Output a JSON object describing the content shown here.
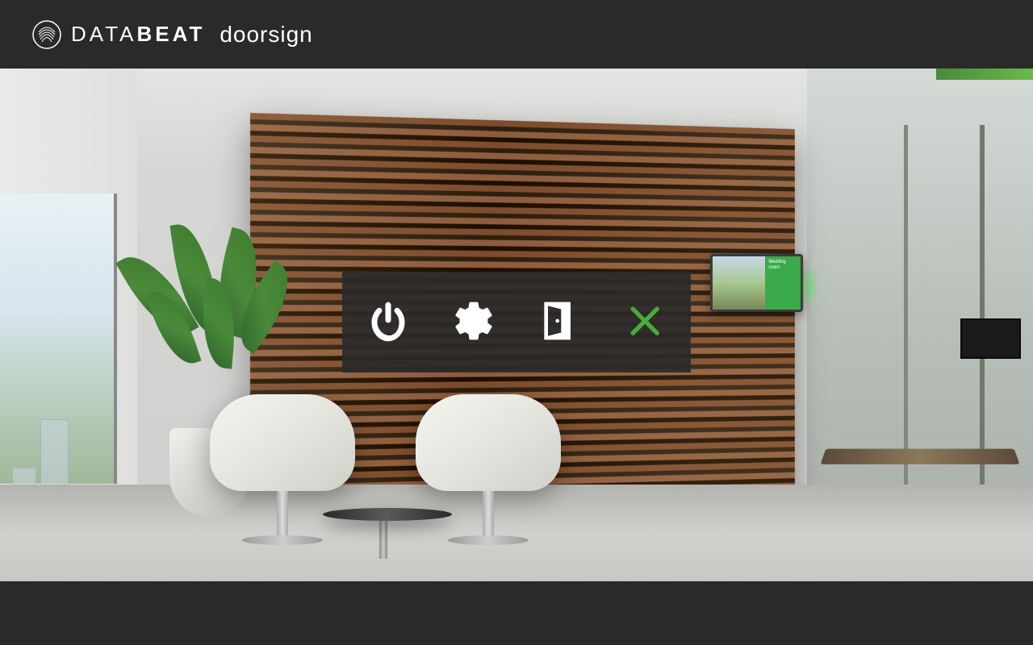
{
  "brand": {
    "name_part1": "DATA",
    "name_part2": "BEAT",
    "product": "doorsign"
  },
  "toolbar": {
    "power_label": "Power",
    "settings_label": "Settings",
    "exit_label": "Exit",
    "close_label": "Close"
  },
  "tablet_display": {
    "status_color": "#4aaa3a",
    "room_label": "Meeting room"
  },
  "colors": {
    "accent_green": "#4aaa3a",
    "chrome_dark": "#2a2a2a",
    "icon_white": "#ffffff"
  }
}
